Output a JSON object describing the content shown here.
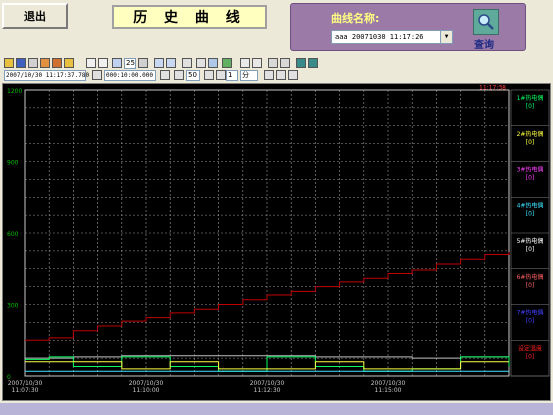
{
  "header": {
    "exit_label": "退出",
    "title": "历 史 曲 线",
    "query_label": "曲线名称:",
    "curve_select_value": "aaa 20071030 11:17:26",
    "query_button_label": "查询"
  },
  "toolbar": {
    "zoom_value": "25",
    "start_time": "2007/10/30 11:17:37.780",
    "span_time": "000:10:00.000",
    "percent_value": "50",
    "step_value": "1",
    "step_unit": "分"
  },
  "colors": {
    "plot_bg": "#000000",
    "grid": "#c8c8c8",
    "axis_text": "#00c000",
    "red_series": "#c00000",
    "accent_purple": "#9c7aa8"
  },
  "chart_data": {
    "type": "line",
    "xlabel": "",
    "ylabel": "",
    "ylim": [
      0,
      1200
    ],
    "y_ticks": [
      "1200",
      "900",
      "600",
      "300",
      "0"
    ],
    "x_ticks": [
      {
        "date": "2007/10/30",
        "time": "11:07:30"
      },
      {
        "date": "2007/10/30",
        "time": "11:10:00"
      },
      {
        "date": "2007/10/30",
        "time": "11:12:30"
      },
      {
        "date": "2007/10/30",
        "time": "11:15:00"
      }
    ],
    "cursor_time": "11:17:38",
    "legend": [
      {
        "name": "1#热电偶",
        "value": "[0]",
        "color": "#00ff60"
      },
      {
        "name": "2#热电偶",
        "value": "[0]",
        "color": "#ffff40"
      },
      {
        "name": "3#热电偶",
        "value": "[0]",
        "color": "#ff40ff"
      },
      {
        "name": "4#热电偶",
        "value": "[0]",
        "color": "#40e0ff"
      },
      {
        "name": "5#热电偶",
        "value": "[0]",
        "color": "#ffffff"
      },
      {
        "name": "6#热电偶",
        "value": "[0]",
        "color": "#ff6060"
      },
      {
        "name": "7#热电偶",
        "value": "[0]",
        "color": "#4040ff"
      },
      {
        "name": "设定温度",
        "value": "[0]",
        "color": "#ff2020"
      }
    ],
    "series": [
      {
        "name": "设定温度",
        "color": "#c00000",
        "x": [
          0,
          0.5,
          1,
          1.5,
          2,
          2.5,
          3,
          3.5,
          4,
          4.5,
          5,
          5.5,
          6,
          6.5,
          7,
          7.5,
          8,
          8.5,
          9,
          9.5,
          10
        ],
        "y": [
          150,
          160,
          190,
          210,
          230,
          245,
          265,
          280,
          300,
          320,
          340,
          355,
          375,
          395,
          410,
          430,
          445,
          470,
          490,
          510,
          520
        ]
      },
      {
        "name": "5#热电偶",
        "color": "#c0c0c0",
        "x": [
          0,
          1,
          2,
          3,
          4,
          5,
          6,
          7,
          8,
          9,
          10
        ],
        "y": [
          75,
          80,
          85,
          85,
          85,
          85,
          80,
          80,
          75,
          80,
          90
        ]
      },
      {
        "name": "1#热电偶",
        "color": "#00ff60",
        "x": [
          0,
          0.5,
          1,
          2,
          3,
          4,
          5,
          6,
          7,
          8,
          9,
          10
        ],
        "y": [
          70,
          80,
          40,
          80,
          40,
          20,
          80,
          40,
          20,
          30,
          80,
          40
        ]
      },
      {
        "name": "2#热电偶",
        "color": "#ffff40",
        "x": [
          0,
          1,
          2,
          3,
          4,
          5,
          6,
          7,
          8,
          9,
          10
        ],
        "y": [
          60,
          60,
          30,
          60,
          30,
          30,
          60,
          30,
          30,
          60,
          60
        ]
      },
      {
        "name": "4#热电偶",
        "color": "#40e0ff",
        "x": [
          0,
          1,
          2,
          3,
          4,
          5,
          6,
          7,
          8,
          9,
          10
        ],
        "y": [
          20,
          20,
          20,
          20,
          20,
          20,
          20,
          20,
          20,
          20,
          20
        ]
      }
    ]
  }
}
